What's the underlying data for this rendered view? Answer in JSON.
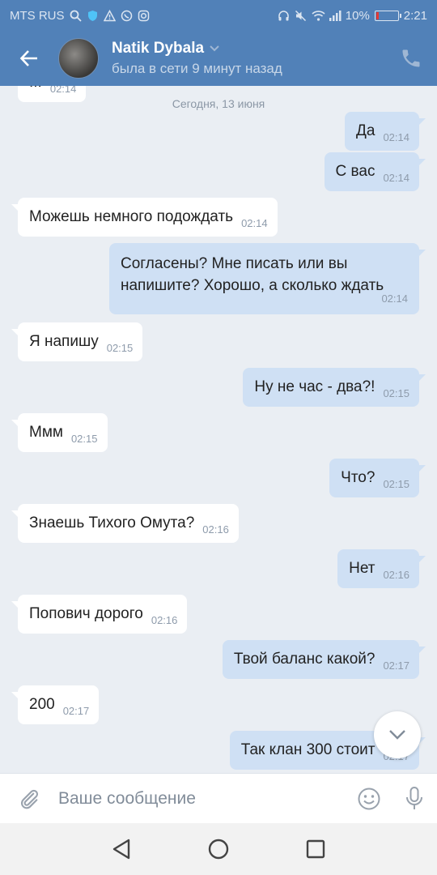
{
  "statusbar": {
    "carrier": "MTS RUS",
    "battery": "10%",
    "battery_level": 0.1,
    "time": "2:21"
  },
  "header": {
    "contact_name": "Natik Dybala",
    "contact_status": "была в сети 9 минут назад"
  },
  "chat": {
    "date_separator": "Сегодня, 13 июня",
    "partial_top": {
      "text": "...",
      "time": "02:14"
    },
    "messages": [
      {
        "dir": "out",
        "text": "Да",
        "time": "02:14"
      },
      {
        "dir": "out",
        "text": "С вас",
        "time": "02:14"
      },
      {
        "dir": "in",
        "text": "Можешь немного подождать",
        "time": "02:14"
      },
      {
        "dir": "out",
        "text": "Согласены? Мне писать или вы напишите? Хорошо, а сколько ждать",
        "time": "02:14"
      },
      {
        "dir": "in",
        "text": "Я напишу",
        "time": "02:15"
      },
      {
        "dir": "out",
        "text": "Ну не час - два?!",
        "time": "02:15"
      },
      {
        "dir": "in",
        "text": "Ммм",
        "time": "02:15"
      },
      {
        "dir": "out",
        "text": "Что?",
        "time": "02:15"
      },
      {
        "dir": "in",
        "text": "Знаешь Тихого Омута?",
        "time": "02:16"
      },
      {
        "dir": "out",
        "text": "Нет",
        "time": "02:16"
      },
      {
        "dir": "in",
        "text": "Попович дорого",
        "time": "02:16"
      },
      {
        "dir": "out",
        "text": "Твой баланс какой?",
        "time": "02:17"
      },
      {
        "dir": "in",
        "text": "200",
        "time": "02:17"
      },
      {
        "dir": "out",
        "text": "Так клан 300 стоит",
        "time": "02:17"
      }
    ]
  },
  "composer": {
    "placeholder": "Ваше сообщение"
  },
  "colors": {
    "header": "#5181b8",
    "outgoing_bubble": "#cfe0f4",
    "incoming_bubble": "#ffffff",
    "background": "#eaeef3"
  },
  "icons": {
    "back": "arrow-left-icon",
    "phone": "phone-icon",
    "attach": "paperclip-icon",
    "emoji": "smiley-icon",
    "mic": "microphone-icon",
    "scroll": "chevron-down-icon"
  }
}
